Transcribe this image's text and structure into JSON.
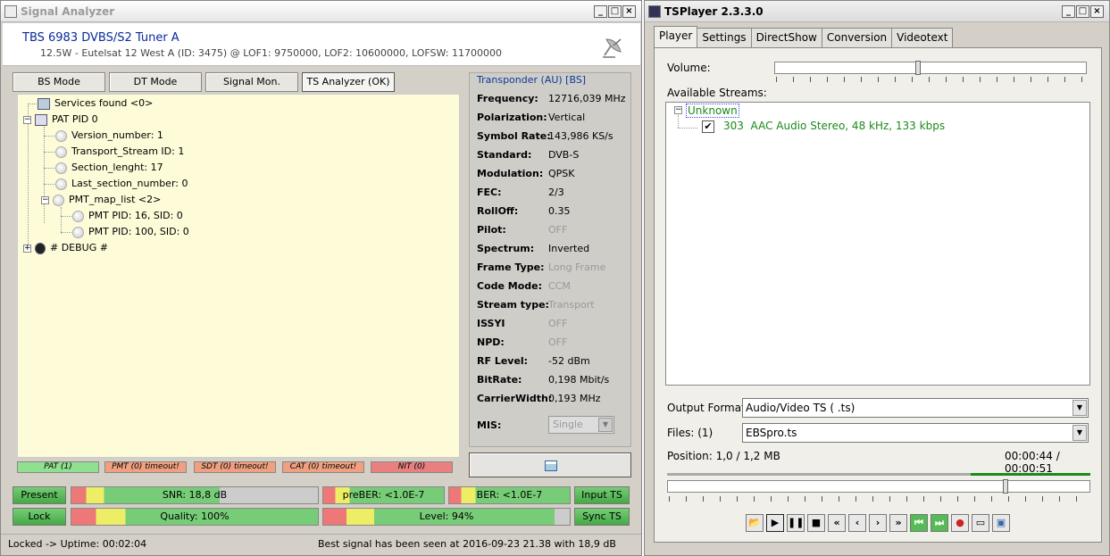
{
  "signal_analyzer": {
    "title": "Signal Analyzer",
    "tuner": "TBS 6983 DVBS/S2 Tuner A",
    "satellite_info": "12.5W - Eutelsat 12 West A (ID: 3475) @ LOF1: 9750000, LOF2: 10600000, LOFSW: 11700000",
    "modes": [
      "BS Mode",
      "DT Mode",
      "Signal Mon.",
      "TS Analyzer (OK)"
    ],
    "tree": {
      "services": "Services found <0>",
      "pat": "PAT PID 0",
      "version": "Version_number: 1",
      "ts_id": "Transport_Stream ID: 1",
      "section_length": "Section_lenght: 17",
      "last_section": "Last_section_number: 0",
      "pmt_list": "PMT_map_list <2>",
      "pmt1": "PMT PID: 16, SID: 0",
      "pmt2": "PMT PID: 100, SID: 0",
      "debug": "# DEBUG #"
    },
    "transponder": {
      "header": "Transponder (AU) [BS]",
      "rows": [
        {
          "key": "Frequency:",
          "value": "12716,039 MHz"
        },
        {
          "key": "Polarization:",
          "value": "Vertical"
        },
        {
          "key": "Symbol Rate:",
          "value": "143,986 KS/s"
        },
        {
          "key": "Standard:",
          "value": "DVB-S"
        },
        {
          "key": "Modulation:",
          "value": "QPSK"
        },
        {
          "key": "FEC:",
          "value": "2/3"
        },
        {
          "key": "RollOff:",
          "value": "0.35"
        },
        {
          "key": "Pilot:",
          "value": "OFF"
        },
        {
          "key": "Spectrum:",
          "value": "Inverted"
        },
        {
          "key": "Frame Type:",
          "value": "Long Frame"
        },
        {
          "key": "Code Mode:",
          "value": "CCM"
        },
        {
          "key": "Stream type:",
          "value": "Transport"
        },
        {
          "key": "ISSYI",
          "value": "OFF"
        },
        {
          "key": "NPD:",
          "value": "OFF"
        },
        {
          "key": "RF Level:",
          "value": "-52 dBm"
        },
        {
          "key": "BitRate:",
          "value": "0,198 Mbit/s"
        },
        {
          "key": "CarrierWidth:",
          "value": "0,193 MHz"
        }
      ],
      "mis_label": "MIS:",
      "mis_value": "Single"
    },
    "status_tables": [
      "PAT (1)",
      "PMT (0) timeout!",
      "SDT (0) timeout!",
      "CAT (0) timeout!",
      "NIT (0)"
    ],
    "status_colors": [
      "#8fe08f",
      "#f0a080",
      "#f0a080",
      "#f0a080",
      "#e88080"
    ],
    "present": "Present",
    "lock": "Lock",
    "snr": "SNR: 18,8 dB",
    "quality": "Quality: 100%",
    "preber": "preBER: <1.0E-7",
    "ber": "BER: <1.0E-7",
    "level": "Level: 94%",
    "input_ts": "Input TS",
    "sync_ts": "Sync TS",
    "levels": {
      "snr": 0.6,
      "quality": 1.0,
      "preber": 1.0,
      "ber": 1.0,
      "level": 0.94
    },
    "status_left": "Locked -> Uptime: 00:02:04",
    "status_right": "Best signal has been seen at 2016-09-23 21.38 with 18,9 dB"
  },
  "tsplayer": {
    "title": "TSPlayer 2.3.3.0",
    "tabs": [
      "Player",
      "Settings",
      "DirectShow",
      "Conversion",
      "Videotext"
    ],
    "volume_label": "Volume:",
    "streams_label": "Available Streams:",
    "group": "Unknown",
    "stream_pid": "303",
    "stream_desc": "AAC Audio Stereo, 48 kHz, 133 kbps",
    "output_label": "Output Format:",
    "output_value": "Audio/Video TS  ( .ts)",
    "files_label": "Files: (1)",
    "files_value": "EBSpro.ts",
    "position": "Position: 1,0 / 1,2 MB",
    "time": "00:00:44 / 00:00:51"
  }
}
